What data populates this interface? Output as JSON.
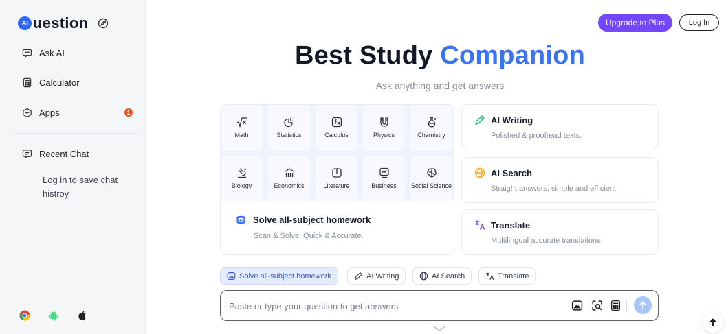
{
  "brand": {
    "logo_badge": "AI",
    "logo_text": "uestion"
  },
  "sidebar": {
    "items": [
      {
        "label": "Ask AI",
        "icon": "chat-icon"
      },
      {
        "label": "Calculator",
        "icon": "calculator-icon"
      },
      {
        "label": "Apps",
        "icon": "apps-icon",
        "badge": "1"
      },
      {
        "label": "Recent Chat",
        "icon": "recent-chat-icon"
      }
    ],
    "login_note": "Log in to save chat histroy",
    "platforms": [
      "chrome-icon",
      "android-icon",
      "apple-icon"
    ]
  },
  "header": {
    "upgrade_label": "Upgrade to Plus",
    "login_label": "Log In"
  },
  "hero": {
    "title_main": "Best Study",
    "title_accent": "Companion",
    "subtitle": "Ask anything and get answers"
  },
  "subjects": [
    {
      "label": "Math",
      "icon": "sqrt-icon"
    },
    {
      "label": "Statistics",
      "icon": "statistics-icon"
    },
    {
      "label": "Calculus",
      "icon": "function-icon"
    },
    {
      "label": "Physics",
      "icon": "magnet-icon"
    },
    {
      "label": "Chemistry",
      "icon": "flask-icon"
    },
    {
      "label": "Biology",
      "icon": "microscope-icon"
    },
    {
      "label": "Economics",
      "icon": "bar-chart-icon"
    },
    {
      "label": "Literature",
      "icon": "book-icon"
    },
    {
      "label": "Business",
      "icon": "business-chart-icon"
    },
    {
      "label": "Social Science",
      "icon": "brain-icon"
    }
  ],
  "homework": {
    "title": "Solve all-subject homework",
    "subtitle": "Scan & Solve, Quick & Accurate."
  },
  "features": [
    {
      "title": "AI Writing",
      "subtitle": "Polished & proofread texts.",
      "icon": "pen-icon"
    },
    {
      "title": "AI Search",
      "subtitle": "Straight answers, simple and efficient.",
      "icon": "globe-icon"
    },
    {
      "title": "Translate",
      "subtitle": "Multilingual accurate translations.",
      "icon": "translate-icon"
    }
  ],
  "chips": [
    {
      "label": "Solve all-subject homework",
      "active": true
    },
    {
      "label": "AI Writing"
    },
    {
      "label": "AI Search"
    },
    {
      "label": "Translate"
    }
  ],
  "ask": {
    "placeholder": "Paste or type your question to get answers"
  },
  "colors": {
    "accent": "#3a74f2",
    "upgrade": "#7346ff",
    "badge": "#f2552c",
    "send": "#a9c6f8"
  }
}
